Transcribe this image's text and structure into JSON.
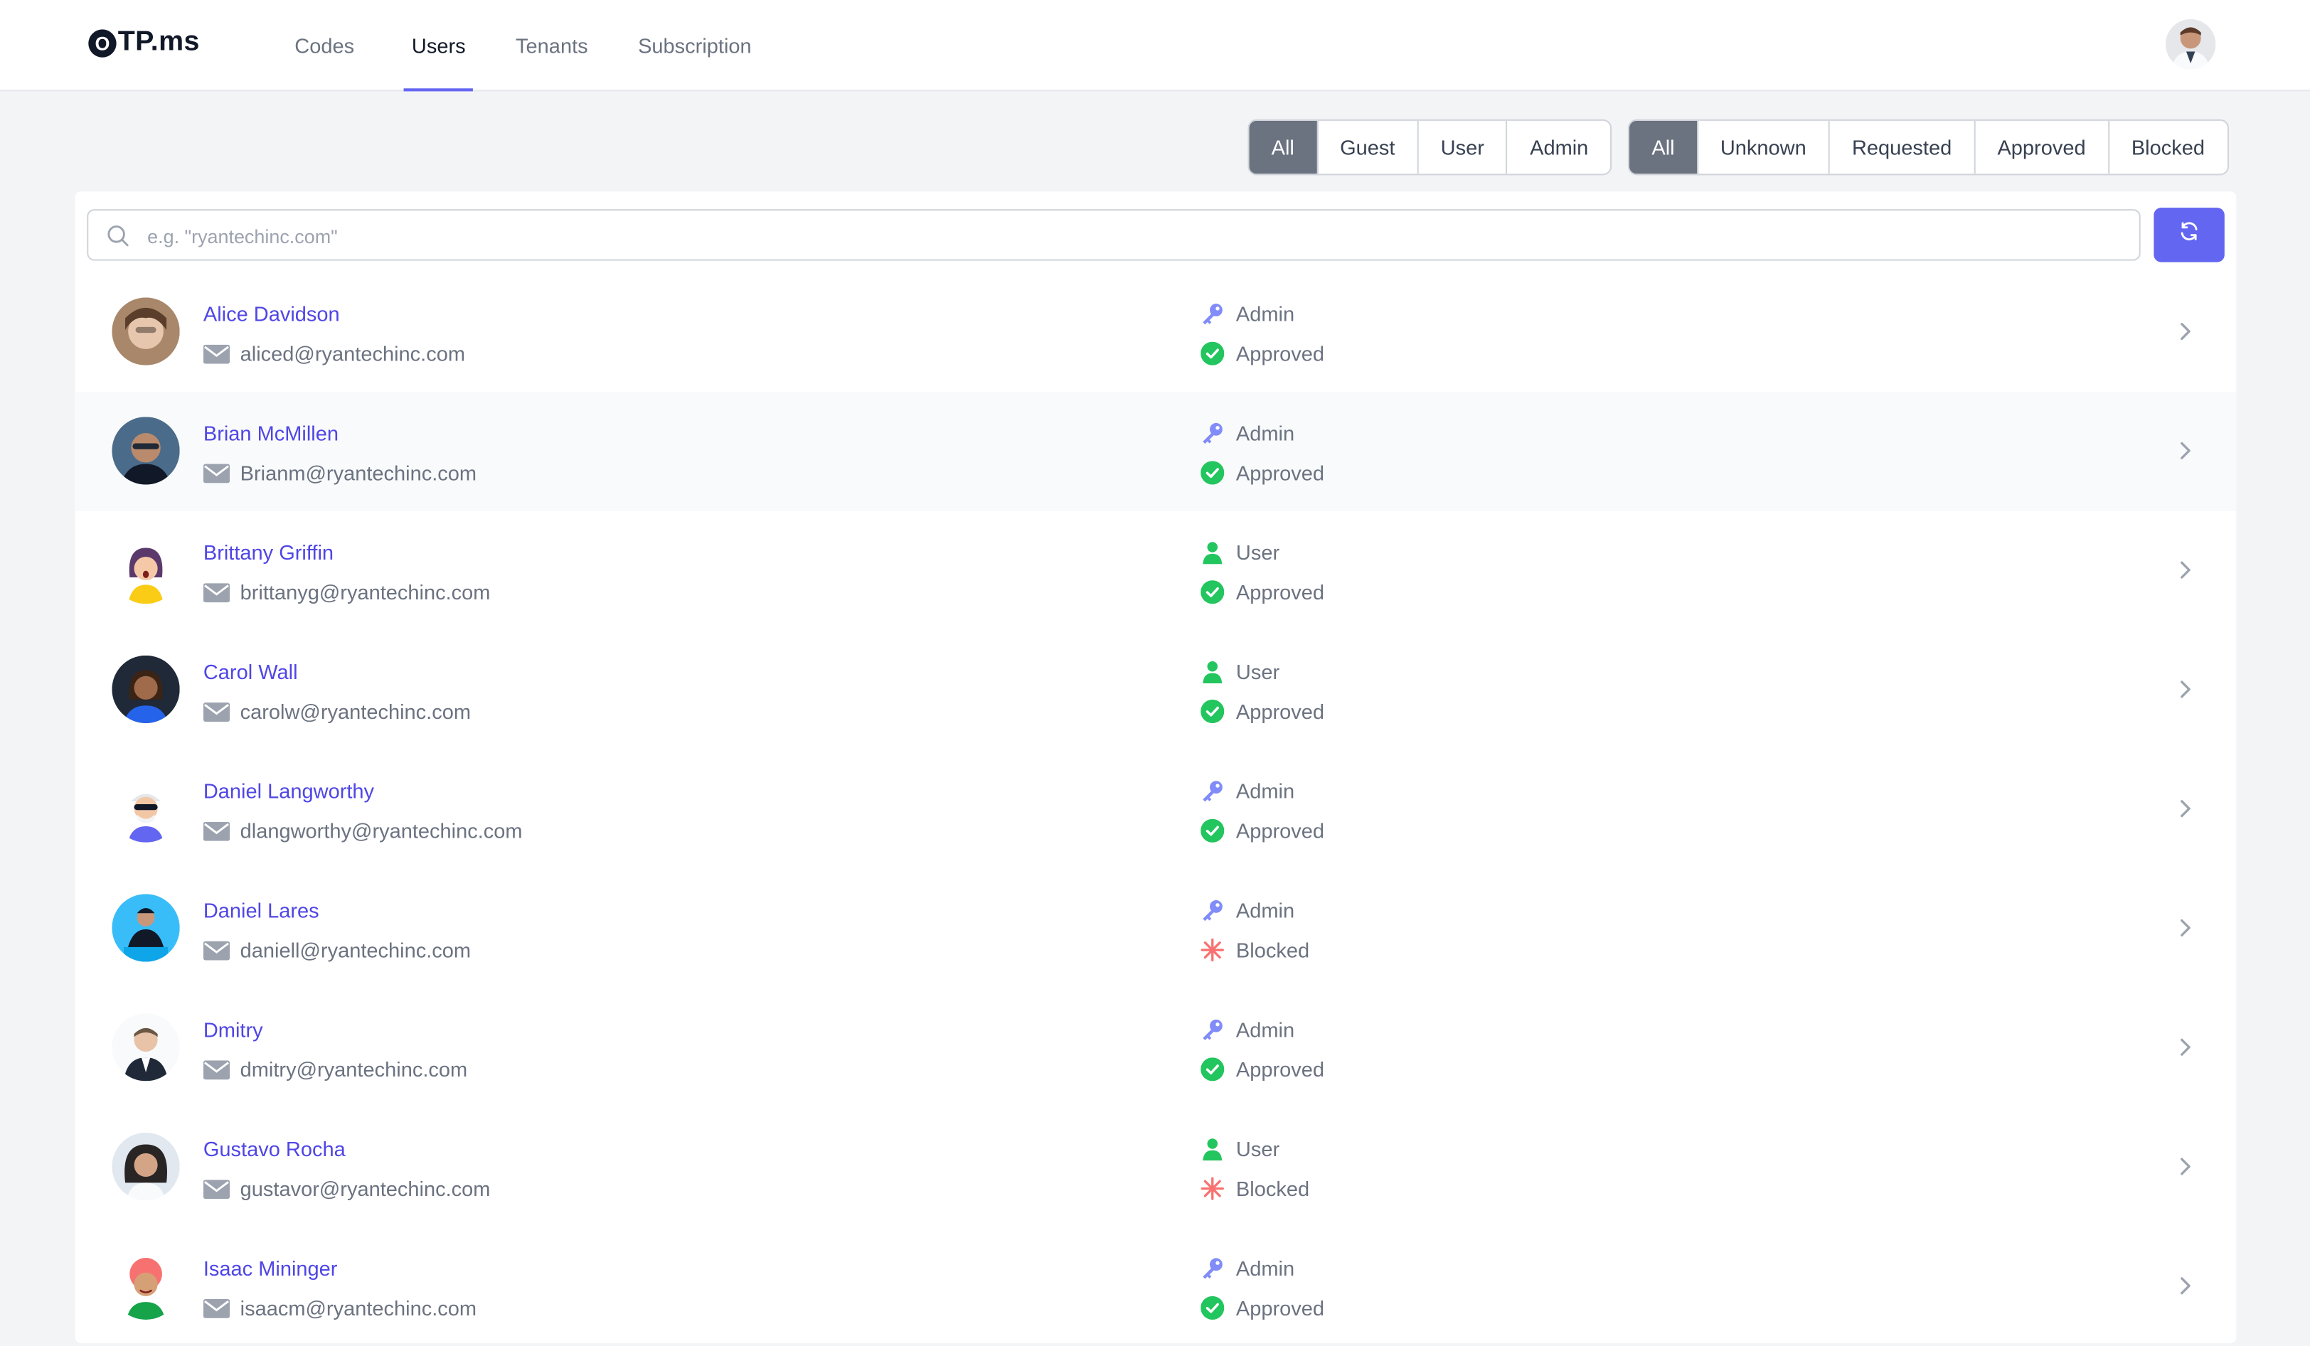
{
  "brand": {
    "logo_mark": "O",
    "logo_text": "TP.ms"
  },
  "nav": [
    {
      "label": "Codes",
      "active": false
    },
    {
      "label": "Users",
      "active": true
    },
    {
      "label": "Tenants",
      "active": false
    },
    {
      "label": "Subscription",
      "active": false
    }
  ],
  "role_filter": [
    "All",
    "Guest",
    "User",
    "Admin"
  ],
  "status_filter": [
    "All",
    "Unknown",
    "Requested",
    "Approved",
    "Blocked"
  ],
  "search": {
    "placeholder": "e.g. \"ryantechinc.com\""
  },
  "colors": {
    "accent": "#6366f1",
    "link": "#4f46e5",
    "approved": "#22c55e",
    "blocked": "#f87171",
    "admin_icon": "#818cf8",
    "user_icon": "#22c55e"
  },
  "users": [
    {
      "name": "Alice Davidson",
      "email": "aliced@ryantechinc.com",
      "role": "Admin",
      "status": "Approved"
    },
    {
      "name": "Brian McMillen",
      "email": "Brianm@ryantechinc.com",
      "role": "Admin",
      "status": "Approved"
    },
    {
      "name": "Brittany Griffin",
      "email": "brittanyg@ryantechinc.com",
      "role": "User",
      "status": "Approved"
    },
    {
      "name": "Carol Wall",
      "email": "carolw@ryantechinc.com",
      "role": "User",
      "status": "Approved"
    },
    {
      "name": "Daniel Langworthy",
      "email": "dlangworthy@ryantechinc.com",
      "role": "Admin",
      "status": "Approved"
    },
    {
      "name": "Daniel Lares",
      "email": "daniell@ryantechinc.com",
      "role": "Admin",
      "status": "Blocked"
    },
    {
      "name": "Dmitry",
      "email": "dmitry@ryantechinc.com",
      "role": "Admin",
      "status": "Approved"
    },
    {
      "name": "Gustavo Rocha",
      "email": "gustavor@ryantechinc.com",
      "role": "User",
      "status": "Blocked"
    },
    {
      "name": "Isaac Mininger",
      "email": "isaacm@ryantechinc.com",
      "role": "Admin",
      "status": "Approved"
    }
  ]
}
